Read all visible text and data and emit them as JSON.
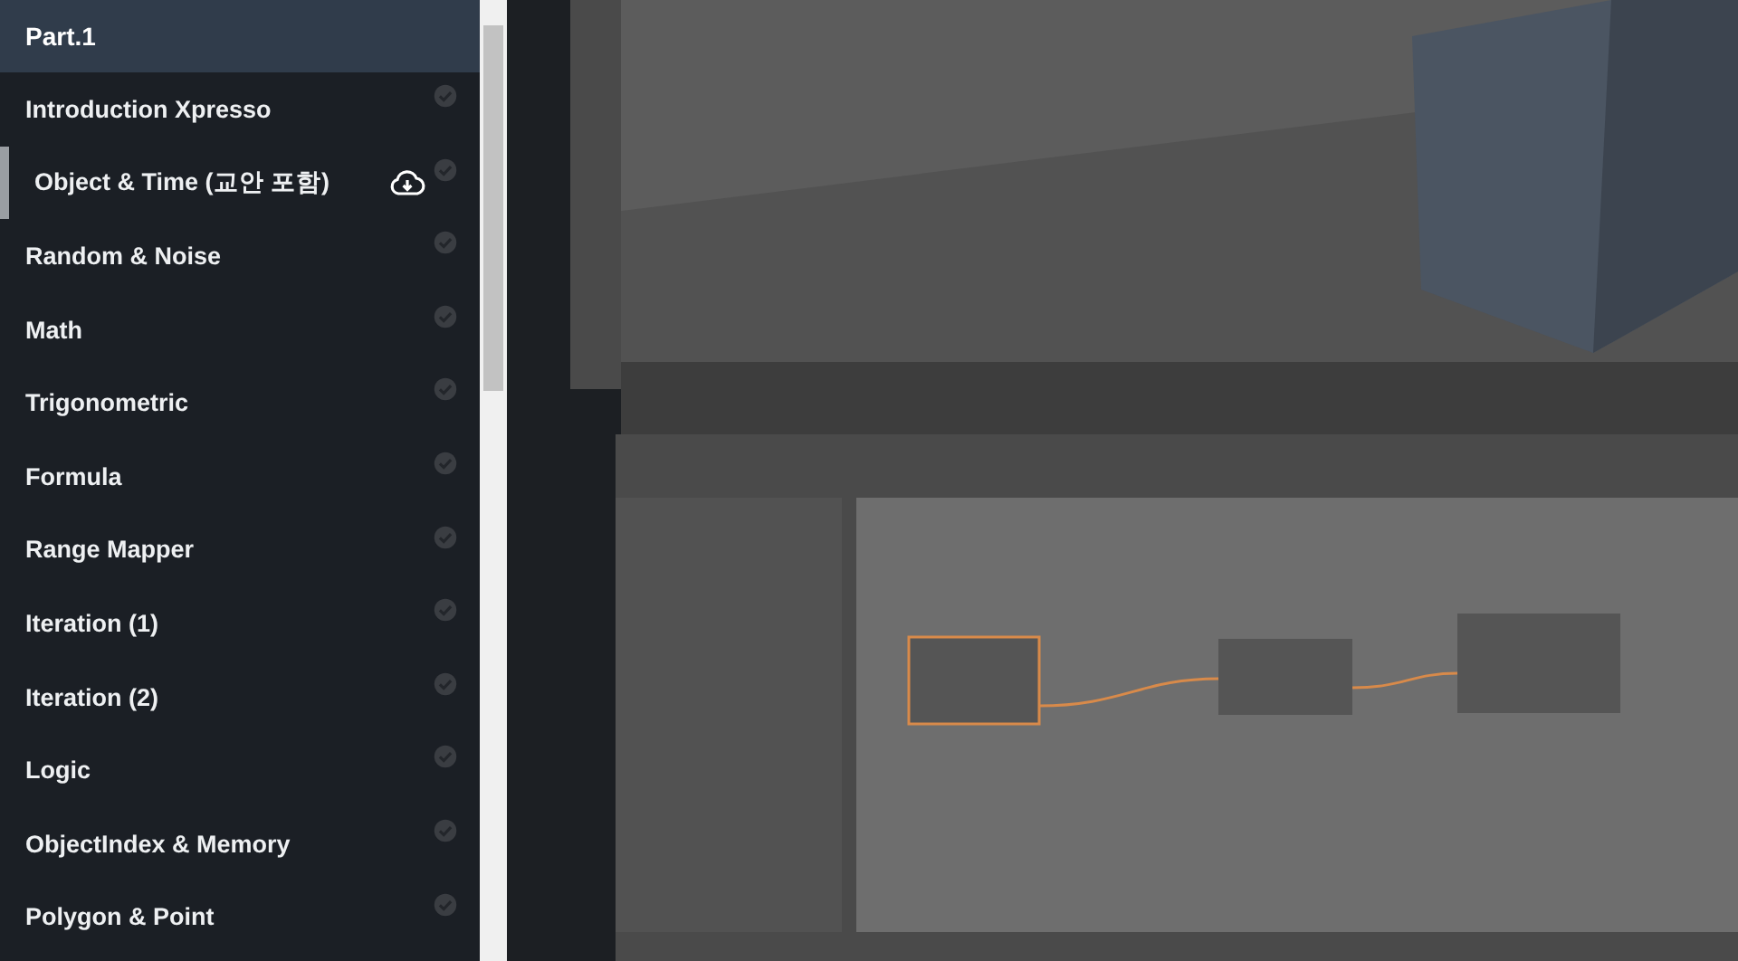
{
  "sidebar": {
    "header": "Part.1",
    "items": [
      {
        "label": "Introduction Xpresso",
        "selected": false,
        "download": false
      },
      {
        "label": "Object & Time (교안 포함)",
        "selected": true,
        "download": true
      },
      {
        "label": "Random & Noise",
        "selected": false,
        "download": false
      },
      {
        "label": "Math",
        "selected": false,
        "download": false
      },
      {
        "label": "Trigonometric",
        "selected": false,
        "download": false
      },
      {
        "label": "Formula",
        "selected": false,
        "download": false
      },
      {
        "label": "Range Mapper",
        "selected": false,
        "download": false
      },
      {
        "label": "Iteration (1)",
        "selected": false,
        "download": false
      },
      {
        "label": "Iteration (2)",
        "selected": false,
        "download": false
      },
      {
        "label": "Logic",
        "selected": false,
        "download": false
      },
      {
        "label": "ObjectIndex & Memory",
        "selected": false,
        "download": false
      },
      {
        "label": "Polygon & Point",
        "selected": false,
        "download": false
      }
    ]
  }
}
